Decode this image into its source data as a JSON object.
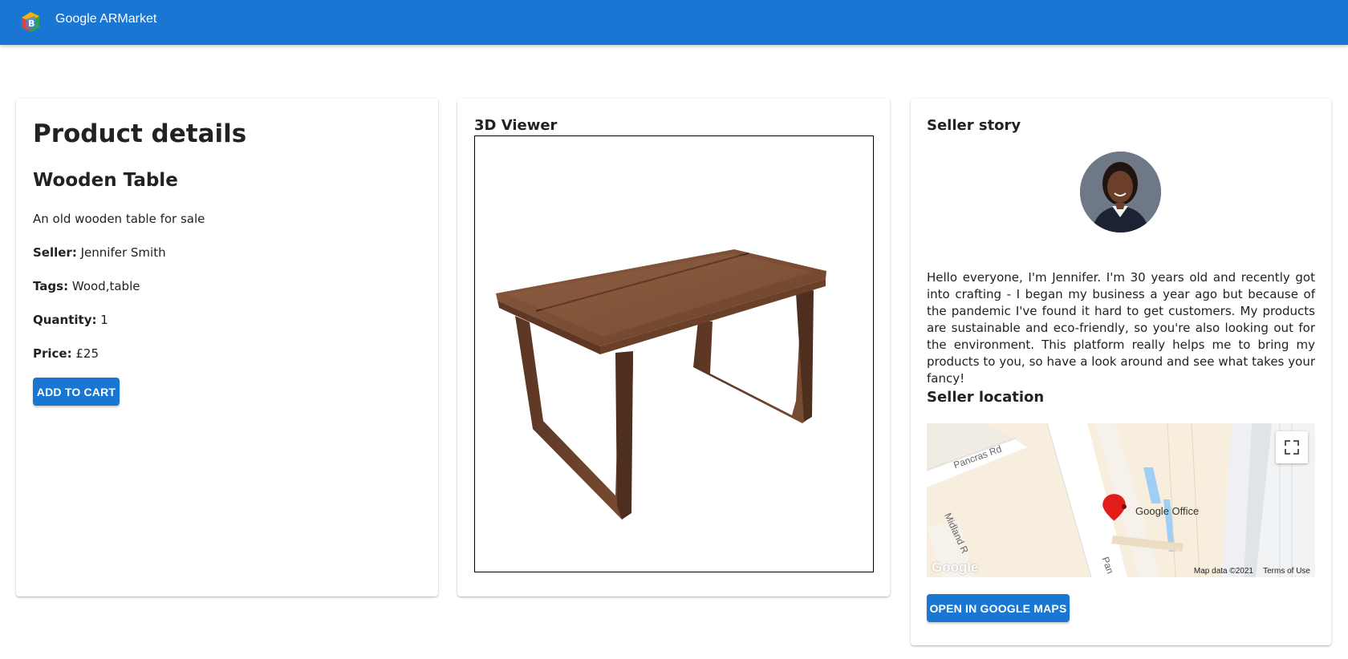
{
  "app": {
    "title": "Google ARMarket"
  },
  "product": {
    "heading": "Product details",
    "name": "Wooden Table",
    "description": "An old wooden table for sale",
    "seller_label": "Seller:",
    "seller": "Jennifer Smith",
    "tags_label": "Tags:",
    "tags": "Wood,table",
    "quantity_label": "Quantity:",
    "quantity": "1",
    "price_label": "Price:",
    "price": "£25",
    "add_to_cart": "ADD TO CART"
  },
  "viewer": {
    "title": "3D Viewer"
  },
  "seller": {
    "story_title": "Seller story",
    "story": "Hello everyone, I'm Jennifer. I'm 30 years old and recently got into crafting - I began my business a year ago but because of the pandemic I've found it hard to get customers. My products are sustainable and eco-friendly, so you're also looking out for the environment. This platform really helps me to bring my products to you, so have a look around and see what takes your fancy!",
    "location_title": "Seller location",
    "open_maps": "OPEN IN GOOGLE MAPS"
  },
  "map": {
    "marker_label": "Google Office",
    "road_1": "Pancras Rd",
    "road_2": "Midland R",
    "road_3": "Pan",
    "map_data": "Map data ©2021",
    "terms": "Terms of Use",
    "google_logo": "Google"
  },
  "colors": {
    "primary": "#1976d2",
    "marker": "#e21b1b",
    "map_bg": "#f7efe0"
  }
}
